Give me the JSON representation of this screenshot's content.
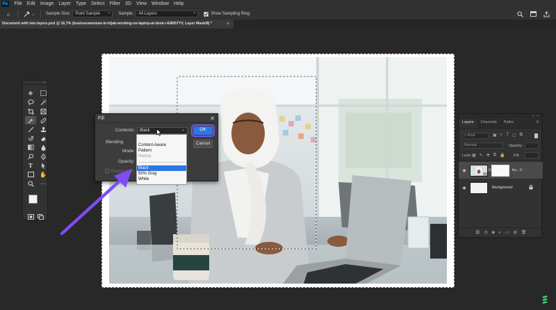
{
  "menubar": {
    "app_icon": "Ps",
    "items": [
      "File",
      "Edit",
      "Image",
      "Layer",
      "Type",
      "Select",
      "Filter",
      "3D",
      "View",
      "Window",
      "Help"
    ]
  },
  "options_bar": {
    "tool_icon": "eyedropper-icon",
    "sample_size_label": "Sample Size:",
    "sample_size_value": "Point Sample",
    "sample_label": "Sample:",
    "sample_value": "All Layers",
    "show_ring_label": "Show Sampling Ring",
    "show_ring_checked": true,
    "right_icons": [
      "search-icon",
      "window-layout-icon",
      "share-icon"
    ]
  },
  "document_tab": {
    "title": "Document with two layers.psd @ 16,7% (businesswoman-in-hijab-working-on-laptop-at-desk-i-E8N57YV, Layer Mask/8) *",
    "close": "×"
  },
  "toolbar": {
    "tools": [
      "move-icon",
      "marquee-icon",
      "lasso-icon",
      "quick-select-icon",
      "crop-icon",
      "frame-icon",
      "eyedropper-icon",
      "healing-icon",
      "brush-icon",
      "clone-stamp-icon",
      "history-brush-icon",
      "eraser-icon",
      "gradient-icon",
      "blur-icon",
      "dodge-icon",
      "pen-icon",
      "type-icon",
      "path-select-icon",
      "rectangle-icon",
      "hand-icon",
      "zoom-icon",
      "more-icon"
    ],
    "active_tool": "eyedropper-icon",
    "foreground_color": "#f4f4f4",
    "background_color": "#0a0a0a"
  },
  "fill_dialog": {
    "title": "Fill",
    "contents_label": "Contents:",
    "contents_value": "Black",
    "blending_label": "Blending",
    "mode_label": "Mode:",
    "opacity_label": "Opacity:",
    "preserve_label": "Preserve Tr",
    "ok_label": "OK",
    "cancel_label": "Cancel",
    "close": "✕"
  },
  "contents_dropdown": {
    "items": [
      {
        "label": "Content-Aware",
        "state": "normal"
      },
      {
        "label": "Pattern",
        "state": "normal"
      },
      {
        "label": "History",
        "state": "disabled"
      },
      {
        "label": "Black",
        "state": "selected"
      },
      {
        "label": "50% Gray",
        "state": "normal"
      },
      {
        "label": "White",
        "state": "normal"
      }
    ]
  },
  "layers_panel": {
    "tabs": [
      "Layers",
      "Channels",
      "Paths"
    ],
    "active_tab": "Layers",
    "search_placeholder": "Kind",
    "blend_mode": "Normal",
    "opacity_label": "Opacity:",
    "lock_label": "Lock:",
    "fill_label": "Fill:",
    "layers": [
      {
        "name": "bu...V",
        "selected": true,
        "has_mask": true
      },
      {
        "name": "Background",
        "selected": false,
        "locked": true
      }
    ],
    "bottom_icons": [
      "link-icon",
      "fx-icon",
      "mask-icon",
      "adjustment-icon",
      "group-icon",
      "new-layer-icon",
      "trash-icon"
    ]
  },
  "colors": {
    "accent": "#2b78e4",
    "annotation": "#7d4df1",
    "panel_bg": "#323232",
    "app_bg": "#282828"
  }
}
